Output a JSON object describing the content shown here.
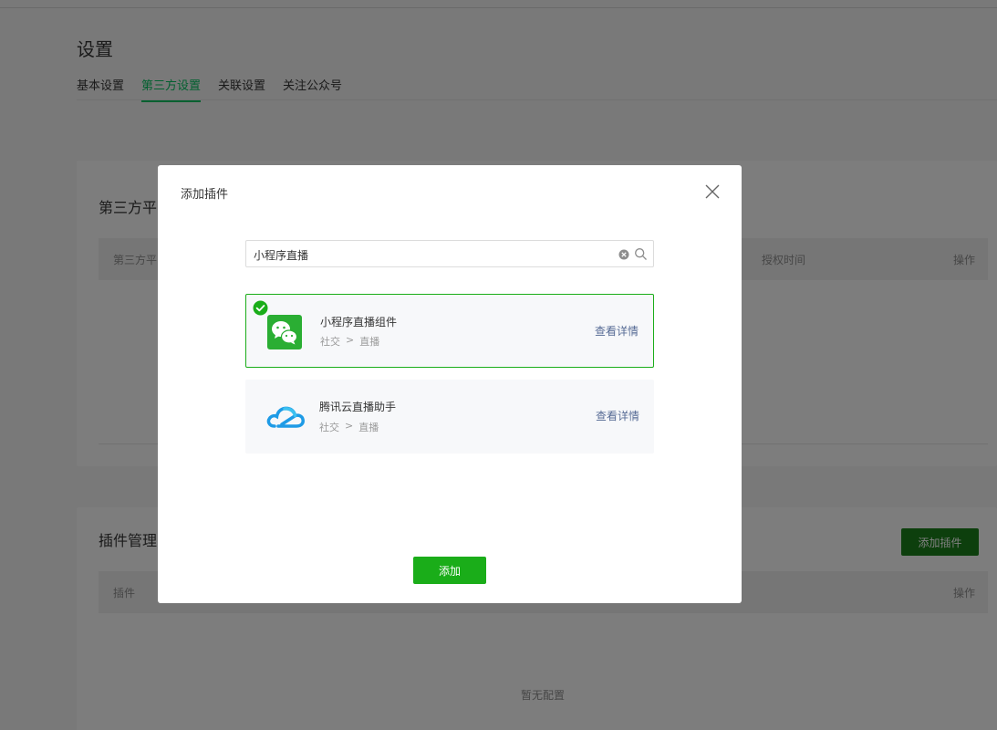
{
  "page": {
    "title": "设置",
    "tabs": [
      {
        "label": "基本设置",
        "active": false
      },
      {
        "label": "第三方设置",
        "active": true
      },
      {
        "label": "关联设置",
        "active": false
      },
      {
        "label": "关注公众号",
        "active": false
      }
    ]
  },
  "third_party_card": {
    "title": "第三方平",
    "columns": {
      "platform": "第三方平",
      "auth_time": "授权时间",
      "action": "操作"
    }
  },
  "plugins_card": {
    "title": "插件管理",
    "add_button": "添加插件",
    "columns": {
      "plugin": "插件",
      "action": "操作"
    },
    "empty_text": "暂无配置"
  },
  "dialog": {
    "title": "添加插件",
    "search": {
      "value": "小程序直播",
      "clear_icon": "clear-circle-icon",
      "search_icon": "search-icon"
    },
    "plugins": [
      {
        "name": "小程序直播组件",
        "category": "社交",
        "separator": ">",
        "subcategory": "直播",
        "detail_link": "查看详情",
        "selected": true,
        "icon": "wechat-icon"
      },
      {
        "name": "腾讯云直播助手",
        "category": "社交",
        "separator": ">",
        "subcategory": "直播",
        "detail_link": "查看详情",
        "selected": false,
        "icon": "tencent-cloud-icon"
      }
    ],
    "submit_label": "添加"
  },
  "colors": {
    "accent": "#07c160",
    "primary_button": "#1aad19",
    "link": "#576b95",
    "overlay": "rgba(0,0,0,0.5)"
  }
}
